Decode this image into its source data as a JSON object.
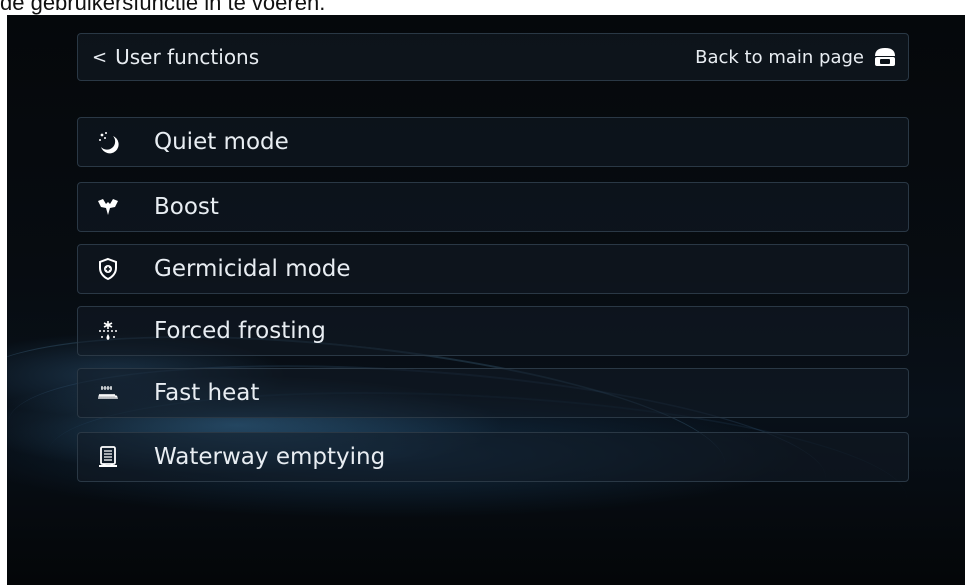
{
  "caption": "de gebruikersfunctie in te voeren.",
  "header": {
    "back_label": "User functions",
    "main_page_label": "Back to main page"
  },
  "items": [
    {
      "label": "Quiet mode",
      "icon": "moon-stars-icon"
    },
    {
      "label": "Boost",
      "icon": "boost-icon"
    },
    {
      "label": "Germicidal mode",
      "icon": "shield-plus-icon"
    },
    {
      "label": "Forced frosting",
      "icon": "snowflake-drop-icon"
    },
    {
      "label": "Fast heat",
      "icon": "heating-coil-icon"
    },
    {
      "label": "Waterway emptying",
      "icon": "water-tank-icon"
    }
  ]
}
